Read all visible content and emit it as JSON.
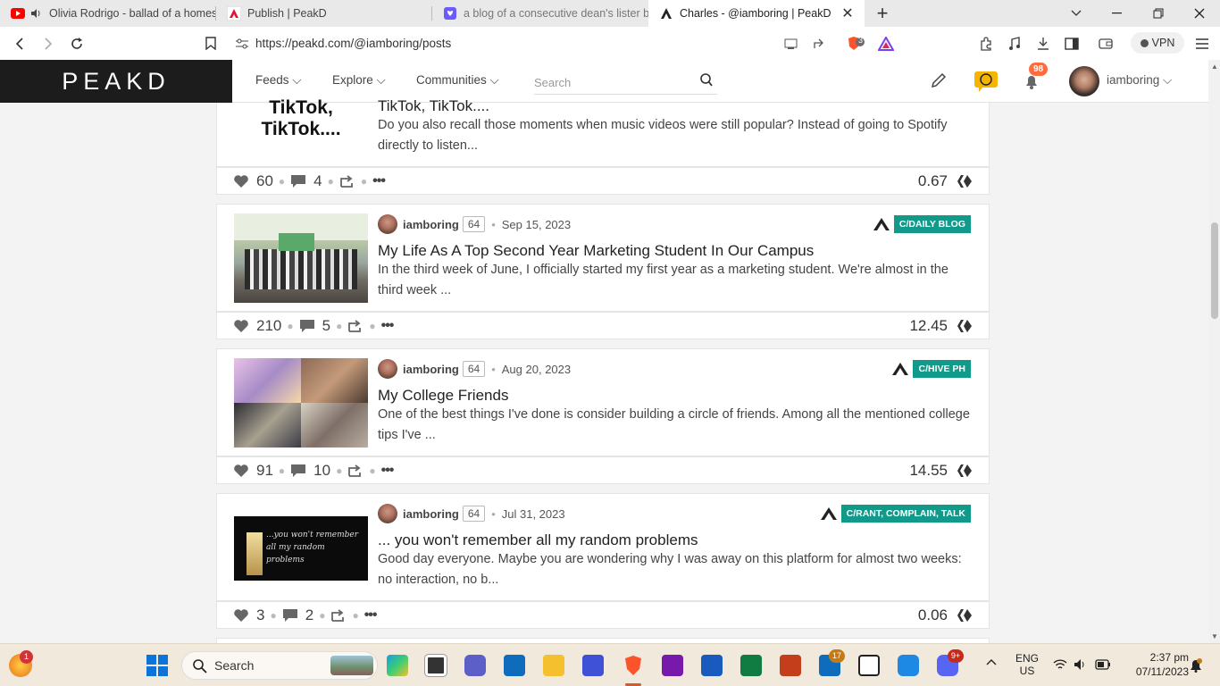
{
  "browser": {
    "tabs": [
      {
        "title": "Olivia Rodrigo - ballad of a homes",
        "favicon": "youtube-icon",
        "audio": true
      },
      {
        "title": "Publish | PeakD",
        "favicon": "peakd-icon"
      },
      {
        "title": "a blog of a consecutive dean's lister b",
        "favicon": "bookmark-heart-icon"
      },
      {
        "title": "Charles - @iamboring | PeakD",
        "favicon": "peakd-icon",
        "active": true
      }
    ],
    "url": "https://peakd.com/@iamboring/posts",
    "shield_count": "3",
    "vpn_label": "VPN"
  },
  "peakd": {
    "logo": "PEAKD",
    "nav": [
      "Feeds",
      "Explore",
      "Communities"
    ],
    "search_placeholder": "Search",
    "notifications": "98",
    "username": "iamboring"
  },
  "posts": [
    {
      "thumb_text": "TikTok,\nTikTok....",
      "title": "TikTok, TikTok....",
      "excerpt": "Do you also recall those moments when music videos were still popular? Instead of going to Spotify directly to listen...",
      "votes": "60",
      "comments": "4",
      "payout": "0.67"
    },
    {
      "author": "iamboring",
      "rep": "64",
      "date": "Sep 15, 2023",
      "community": "C/DAILY BLOG",
      "title": "My Life As A Top Second Year Marketing Student In Our Campus",
      "excerpt": "In the third week of June, I officially started my first year as a marketing student. We're almost in the third week ...",
      "votes": "210",
      "comments": "5",
      "payout": "12.45"
    },
    {
      "author": "iamboring",
      "rep": "64",
      "date": "Aug 20, 2023",
      "community": "C/HIVE PH",
      "title": "My College Friends",
      "excerpt": "One of the best things I've done is consider building a circle of friends. Among all the mentioned college tips I've ...",
      "votes": "91",
      "comments": "10",
      "payout": "14.55"
    },
    {
      "author": "iamboring",
      "rep": "64",
      "date": "Jul 31, 2023",
      "community": "C/RANT, COMPLAIN, TALK",
      "thumb_text": "...you won't remember all my random problems",
      "title": "... you won't remember all my random problems",
      "excerpt": "Good day everyone. Maybe you are wondering why I was away on this platform for almost two weeks: no interaction, no b...",
      "votes": "3",
      "comments": "2",
      "payout": "0.06"
    }
  ],
  "taskbar": {
    "search_label": "Search",
    "widget_badge": "1",
    "store_badge": "17",
    "discord_badge": "9+",
    "lang": "ENG",
    "region": "US",
    "time": "2:37 pm",
    "date": "07/11/2023"
  },
  "colors": {
    "accent": "#11998a",
    "brand_red": "#e31337",
    "header_dark": "#1c1c1c"
  }
}
